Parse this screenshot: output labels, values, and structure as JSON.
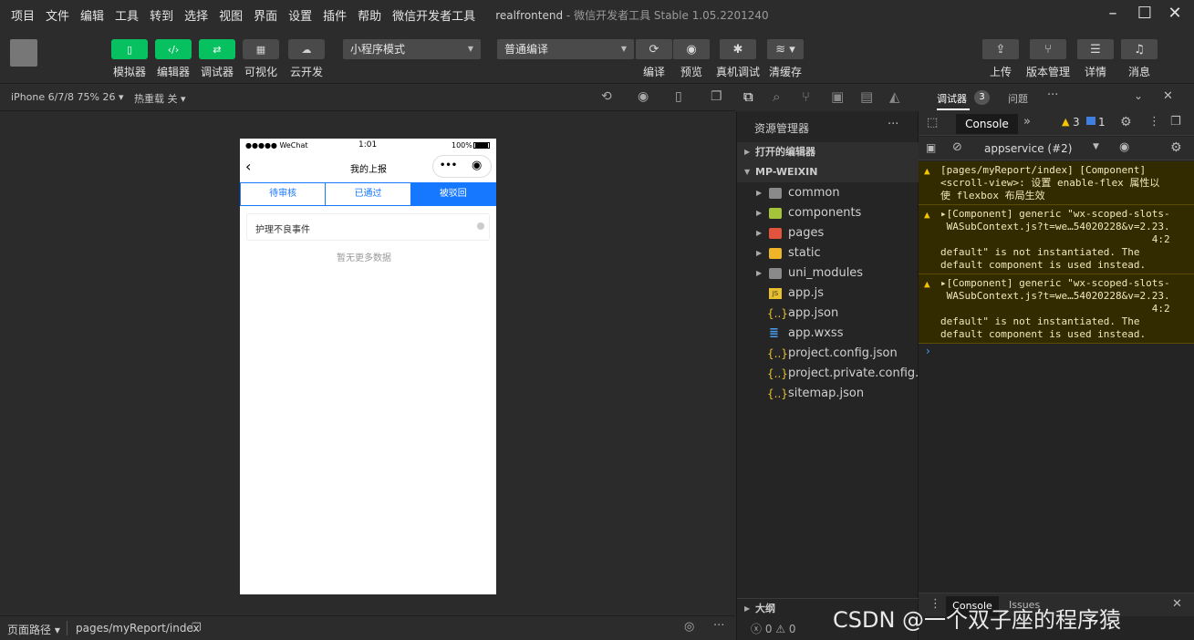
{
  "menu": [
    "项目",
    "文件",
    "编辑",
    "工具",
    "转到",
    "选择",
    "视图",
    "界面",
    "设置",
    "插件",
    "帮助",
    "微信开发者工具"
  ],
  "window": {
    "app_name": "realfrontend",
    "subtitle": "- 微信开发者工具 Stable 1.05.2201240"
  },
  "toolbar": {
    "left_buttons": [
      "模拟器",
      "编辑器",
      "调试器",
      "可视化",
      "云开发"
    ],
    "mode_select": "小程序模式",
    "compile_select": "普通编译",
    "mid_buttons": [
      "编译",
      "预览",
      "真机调试",
      "清缓存"
    ],
    "right_buttons": [
      "上传",
      "版本管理",
      "详情",
      "消息"
    ]
  },
  "simulator": {
    "device": "iPhone 6/7/8 75% 26",
    "hot_reload": "热重载 关",
    "carrier": "●●●●● WeChat",
    "time": "1:01",
    "battery": "100%",
    "page_title": "我的上报",
    "tabs": [
      "待审核",
      "已通过",
      "被驳回"
    ],
    "active_tab": 2,
    "list_item": "护理不良事件",
    "empty_text": "暂无更多数据"
  },
  "bottom_bar": {
    "path_label": "页面路径",
    "path": "pages/myReport/index"
  },
  "explorer": {
    "title": "资源管理器",
    "open_editors": "打开的编辑器",
    "project": "MP-WEIXIN",
    "folders": [
      "common",
      "components",
      "pages",
      "static",
      "uni_modules"
    ],
    "files": [
      "app.js",
      "app.json",
      "app.wxss",
      "project.config.json",
      "project.private.config.js...",
      "sitemap.json"
    ],
    "outline": "大纲",
    "status": "ⓧ 0 ⚠ 0"
  },
  "debugger": {
    "tab_main": "调试器",
    "tab_badge": "3",
    "tab_issues": "问题",
    "console_tab": "Console",
    "warn_count": "3",
    "info_count": "1",
    "context": "appservice (#2)",
    "warnings": [
      "[pages/myReport/index] [Component]\n<scroll-view>: 设置 enable-flex 属性以\n使 flexbox 布局生效",
      "▸[Component] generic \"wx-scoped-slots-\n WASubContext.js?t=we…54020228&v=2.23.\n                                   4:2\ndefault\" is not instantiated. The\ndefault component is used instead.",
      "▸[Component] generic \"wx-scoped-slots-\n WASubContext.js?t=we…54020228&v=2.23.\n                                   4:2\ndefault\" is not instantiated. The\ndefault component is used instead."
    ],
    "drawer_tabs": [
      "Console",
      "Issues"
    ]
  },
  "watermark": "CSDN @一个双子座的程序猿"
}
